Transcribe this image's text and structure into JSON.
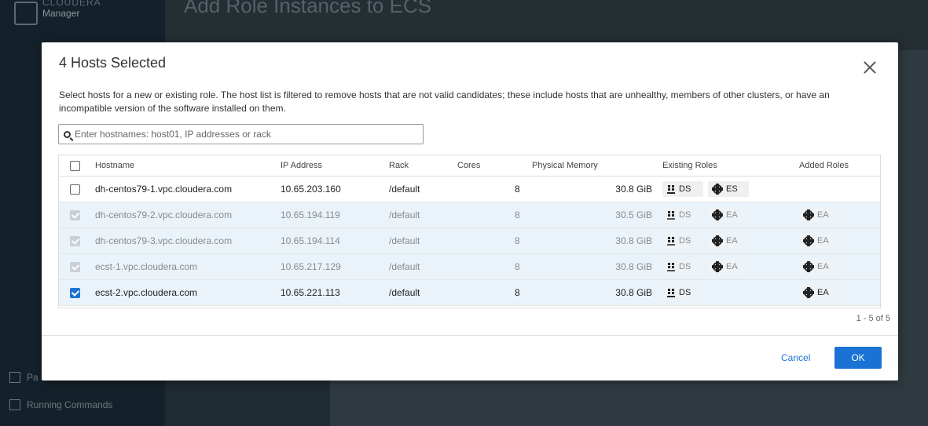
{
  "app": {
    "brand_line1": "CLOUDERA",
    "brand_line2": "Manager",
    "page_title": "Add Role Instances to ECS",
    "side_items": [
      {
        "label": "Pa",
        "icon": "parcel-icon"
      },
      {
        "label": "Running Commands",
        "icon": "hourglass-icon"
      }
    ]
  },
  "modal": {
    "title": "4 Hosts Selected",
    "description": "Select hosts for a new or existing role. The host list is filtered to remove hosts that are not valid candidates; these include hosts that are unhealthy, members of other clusters, or have an incompatible version of the software installed on them.",
    "search_placeholder": "Enter hostnames: host01, IP addresses or rack",
    "columns": [
      "Hostname",
      "IP Address",
      "Rack",
      "Cores",
      "Physical Memory",
      "Existing Roles",
      "Added Roles"
    ],
    "rows": [
      {
        "hostname": "dh-centos79-1.vpc.cloudera.com",
        "ip": "10.65.203.160",
        "rack": "/default",
        "cores": "8",
        "memory": "30.8 GiB",
        "existing": [
          "DS",
          "ES"
        ],
        "added": [],
        "state": "unchecked"
      },
      {
        "hostname": "dh-centos79-2.vpc.cloudera.com",
        "ip": "10.65.194.119",
        "rack": "/default",
        "cores": "8",
        "memory": "30.5 GiB",
        "existing": [
          "DS",
          "EA"
        ],
        "added": [
          "EA"
        ],
        "state": "disabled"
      },
      {
        "hostname": "dh-centos79-3.vpc.cloudera.com",
        "ip": "10.65.194.114",
        "rack": "/default",
        "cores": "8",
        "memory": "30.8 GiB",
        "existing": [
          "DS",
          "EA"
        ],
        "added": [
          "EA"
        ],
        "state": "disabled"
      },
      {
        "hostname": "ecst-1.vpc.cloudera.com",
        "ip": "10.65.217.129",
        "rack": "/default",
        "cores": "8",
        "memory": "30.8 GiB",
        "existing": [
          "DS",
          "EA"
        ],
        "added": [
          "EA"
        ],
        "state": "disabled"
      },
      {
        "hostname": "ecst-2.vpc.cloudera.com",
        "ip": "10.65.221.113",
        "rack": "/default",
        "cores": "8",
        "memory": "30.8 GiB",
        "existing": [
          "DS"
        ],
        "added": [
          "EA"
        ],
        "state": "checked"
      }
    ],
    "pager": "1 - 5 of 5",
    "cancel_label": "Cancel",
    "ok_label": "OK"
  },
  "colors": {
    "accent": "#1a73d4",
    "selected_row": "#eaf3fa"
  }
}
